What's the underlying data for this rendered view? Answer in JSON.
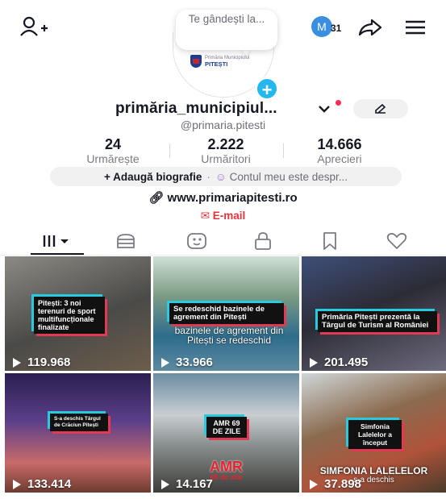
{
  "header": {
    "thought_bubble": "Te gândești la...",
    "avatar_logo_line1": "Primăria Municipiului",
    "avatar_logo_line2": "PITEȘTI",
    "notif_letter": "M",
    "notif_count": "31"
  },
  "profile": {
    "username": "primăria_municipiul...",
    "handle": "@primaria.pitesti",
    "stats": [
      {
        "value": "24",
        "label": "Urmărește"
      },
      {
        "value": "2.222",
        "label": "Urmăritori"
      },
      {
        "value": "14.666",
        "label": "Aprecieri"
      }
    ],
    "bio_add": "+ Adaugă biografie",
    "bio_sep": "·",
    "bio_about": "Contul meu este despr...",
    "website": "www.primariapitesti.ro",
    "email": "E-mail"
  },
  "tabs": [
    "videos-icon",
    "shop-icon",
    "reposts-icon",
    "private-icon",
    "favorites-icon",
    "liked-icon"
  ],
  "videos": [
    {
      "caption": "Pitești: 3 noi terenuri de sport multifuncționale finalizate",
      "views": "119.968",
      "bg": "#5b5a55"
    },
    {
      "caption": "Se redeschid bazinele de agrement din Pitești",
      "overlay": "bazinele de agrement din Pitești se redeschid",
      "views": "33.966",
      "bg": "#6a8fa3"
    },
    {
      "caption": "Primăria Pitești prezentă la Târgul de Turism al României",
      "views": "201.495",
      "bg": "#4a4f67"
    },
    {
      "caption": "S-a deschis Târgul de Crăciun Pitești",
      "views": "133.414",
      "bg": "#3b2d5a"
    },
    {
      "caption": "AMR 69 DE ZILE",
      "overlay": "AMR",
      "overlay2": "69 de zile",
      "views": "14.167",
      "bg": "#7c8a8f"
    },
    {
      "caption": "Simfonia Lalelelor a început",
      "overlay": "SIMFONIA LALELELOR",
      "overlay2": "s-a deschis",
      "views": "37.898",
      "bg": "#6b4a3a"
    }
  ]
}
